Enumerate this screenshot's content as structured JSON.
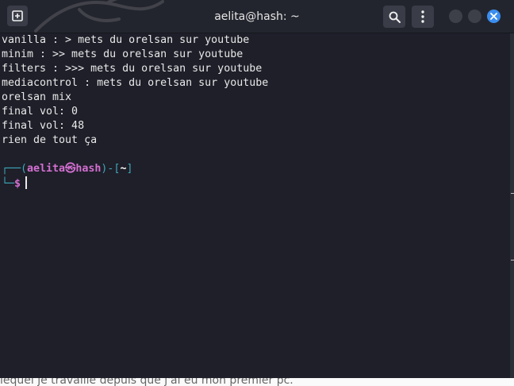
{
  "window": {
    "title": "aelita@hash: ~",
    "icons": {
      "new_tab": "new-tab-icon",
      "search": "search-icon",
      "menu": "kebab-menu-icon",
      "minimize": "minimize-icon",
      "maximize": "maximize-icon",
      "close": "close-icon"
    },
    "colors": {
      "titlebar": "#23252e",
      "close_button": "#3b8ef0",
      "terminal_bg": "#1e1f29"
    }
  },
  "terminal": {
    "output_lines": [
      "vanilla : > mets du orelsan sur youtube",
      "minim : >> mets du orelsan sur youtube",
      "filters : >>> mets du orelsan sur youtube",
      "mediacontrol : mets du orelsan sur youtube",
      "orelsan mix",
      "final vol: 0",
      "final vol: 48",
      "rien de tout ça"
    ],
    "prompt": {
      "corner_top": "┌──(",
      "user": "aelita",
      "at_symbol": "㉿",
      "host": "hash",
      "separator": ")-[",
      "cwd": "~",
      "close_bracket": "]",
      "corner_bottom": "└─",
      "symbol": "$",
      "colors": {
        "frame": "#3fa7b8",
        "user_host": "#d36fd1",
        "cwd": "#ffffff",
        "symbol": "#d36fd1"
      }
    },
    "input_value": ""
  },
  "background_page_text": "lequel je travaille depuis que j'ai eu mon premier pc."
}
